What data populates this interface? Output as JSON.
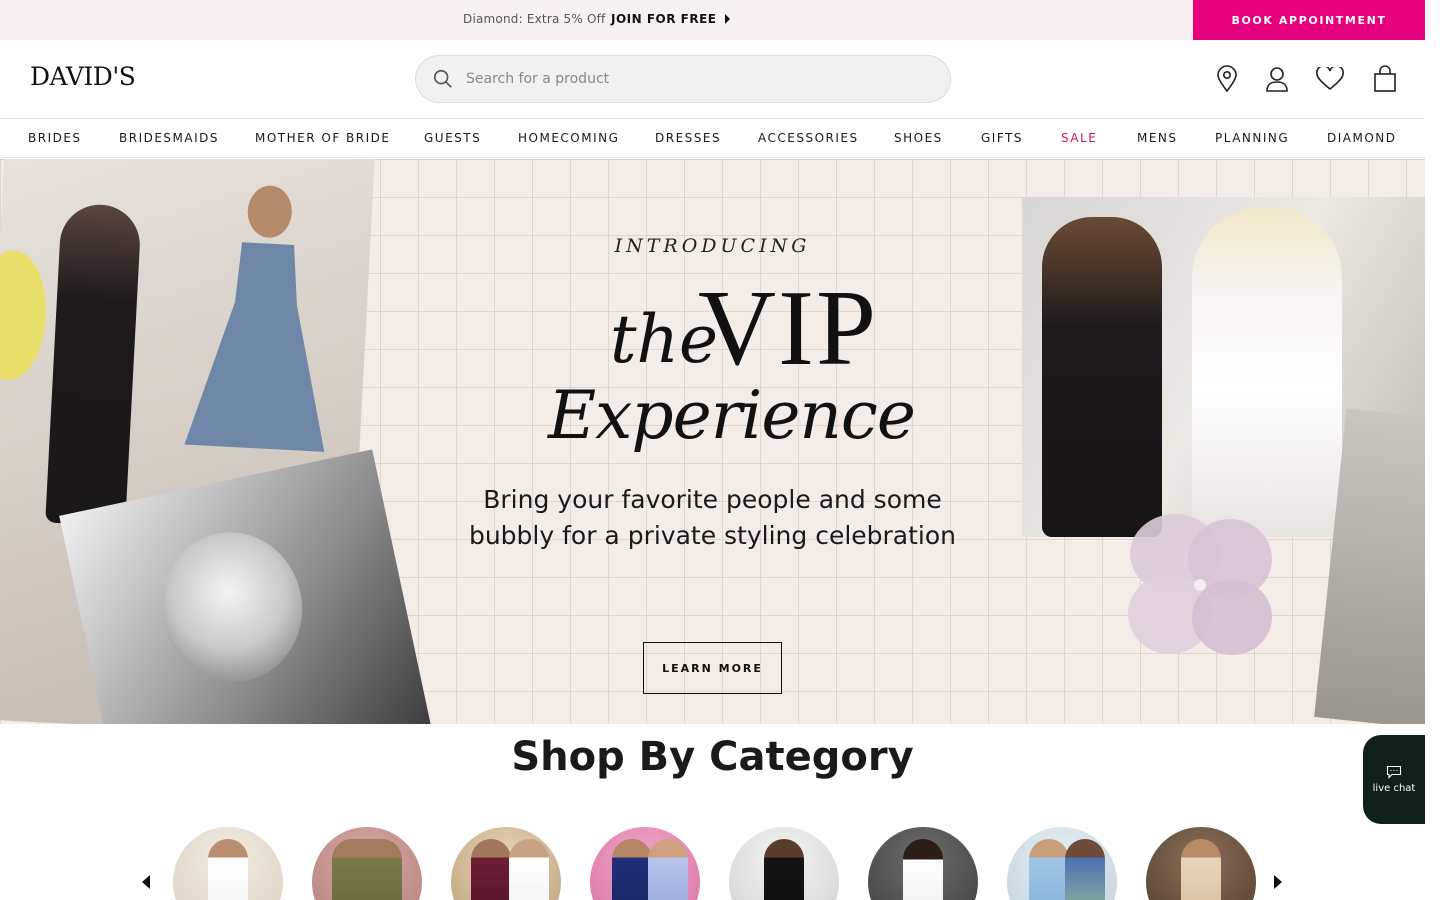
{
  "promo": {
    "text": "Diamond: Extra 5% Off",
    "link_label": "JOIN FOR FREE",
    "book_button": "BOOK APPOINTMENT"
  },
  "header": {
    "logo": "DAVID'S",
    "search_placeholder": "Search for a product",
    "icons": [
      "location-icon",
      "account-icon",
      "heart-icon",
      "bag-icon"
    ]
  },
  "nav": {
    "items": [
      "BRIDES",
      "BRIDESMAIDS",
      "MOTHER OF BRIDE",
      "GUESTS",
      "HOMECOMING",
      "DRESSES",
      "ACCESSORIES",
      "SHOES",
      "GIFTS",
      "SALE",
      "MENS",
      "PLANNING",
      "DIAMOND"
    ],
    "sale_color": "#d6145a"
  },
  "hero": {
    "intro": "INTRODUCING",
    "title_the": "the",
    "title_vip": "VIP",
    "title_experience": "Experience",
    "subtitle_line1": "Bring your favorite people and some",
    "subtitle_line2": "bubbly for a private styling celebration",
    "cta": "LEARN MORE"
  },
  "categories": {
    "title": "Shop By Category"
  },
  "live_chat": {
    "label": "live chat"
  },
  "colors": {
    "accent": "#e6007e",
    "promo_bg": "#f8f1f3",
    "chat_bg": "#0f1f1a"
  }
}
